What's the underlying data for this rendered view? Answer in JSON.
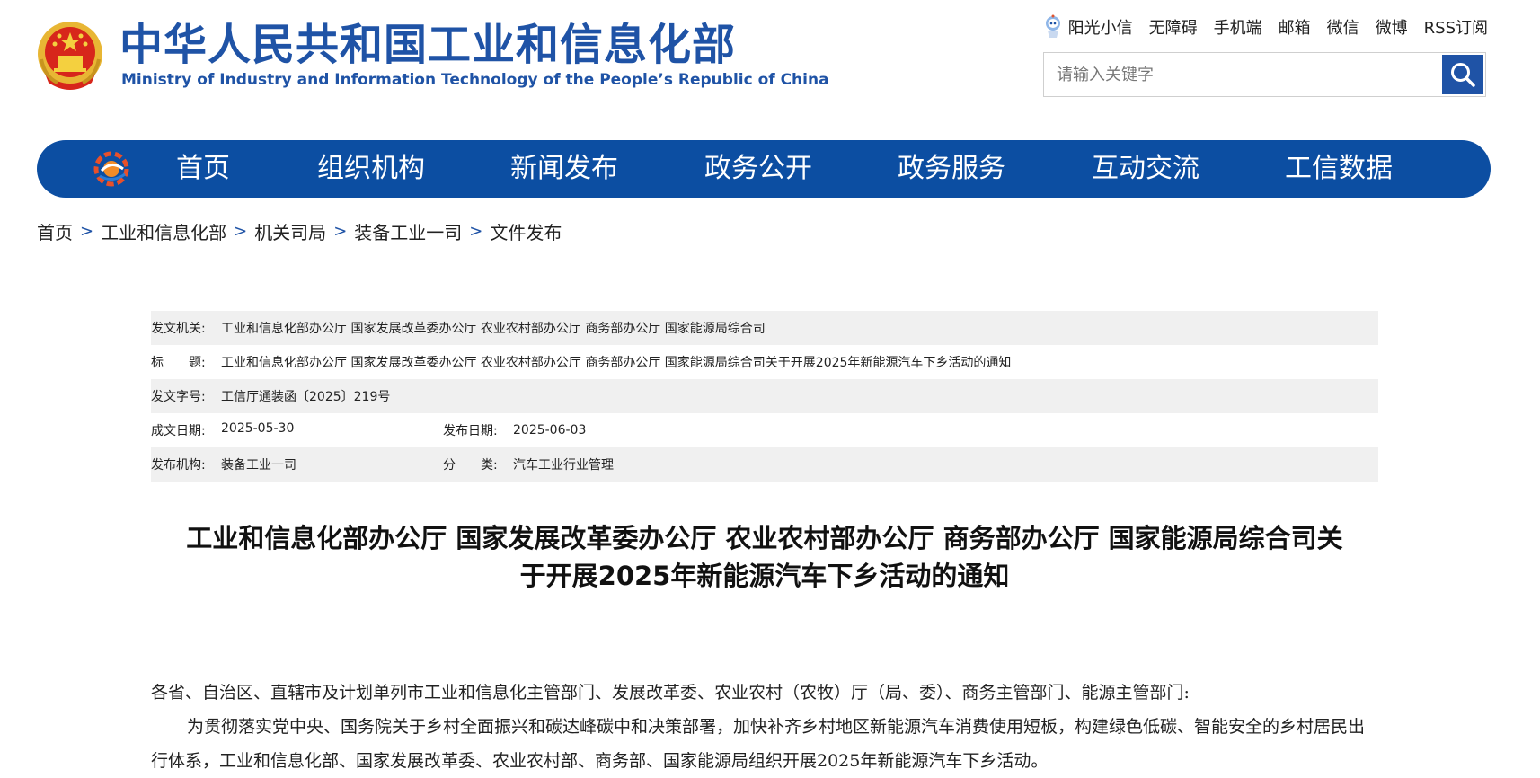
{
  "header": {
    "title": "中华人民共和国工业和信息化部",
    "subtitle": "Ministry of Industry and Information Technology of the People’s Republic of China",
    "top_links": [
      "阳光小信",
      "无障碍",
      "手机端",
      "邮箱",
      "微信",
      "微博",
      "RSS订阅"
    ],
    "search": {
      "placeholder": "请输入关键字",
      "value": ""
    },
    "colors": {
      "brand": "#1f53a6",
      "nav": "#0c4ea2"
    }
  },
  "nav": {
    "items": [
      "首页",
      "组织机构",
      "新闻发布",
      "政务公开",
      "政务服务",
      "互动交流",
      "工信数据"
    ]
  },
  "breadcrumb": [
    "首页",
    "工业和信息化部",
    "机关司局",
    "装备工业一司",
    "文件发布"
  ],
  "meta": {
    "issuer_label": "发文机关:",
    "issuer_value": "工业和信息化部办公厅 国家发展改革委办公厅 农业农村部办公厅 商务部办公厅 国家能源局综合司",
    "title_label": "标　　题:",
    "title_value": "工业和信息化部办公厅 国家发展改革委办公厅 农业农村部办公厅 商务部办公厅 国家能源局综合司关于开展2025年新能源汽车下乡活动的通知",
    "docno_label": "发文字号:",
    "docno_value": "工信厅通装函〔2025〕219号",
    "created_label": "成文日期:",
    "created_value": "2025-05-30",
    "published_label": "发布日期:",
    "published_value": "2025-06-03",
    "org_label": "发布机构:",
    "org_value": "装备工业一司",
    "category_label": "分　　类:",
    "category_value": "汽车工业行业管理"
  },
  "article": {
    "title_line1": "工业和信息化部办公厅 国家发展改革委办公厅 农业农村部办公厅 商务部办公厅 国家能源局综合司关",
    "title_line2": "于开展2025年新能源汽车下乡活动的通知",
    "salutation": "各省、自治区、直辖市及计划单列市工业和信息化主管部门、发展改革委、农业农村（农牧）厅（局、委）、商务主管部门、能源主管部门:",
    "paragraph1": "为贯彻落实党中央、国务院关于乡村全面振兴和碳达峰碳中和决策部署，加快补齐乡村地区新能源汽车消费使用短板，构建绿色低碳、智能安全的乡村居民出行体系，工业和信息化部、国家发展改革委、农业农村部、商务部、国家能源局组织开展2025年新能源汽车下乡活动。"
  }
}
